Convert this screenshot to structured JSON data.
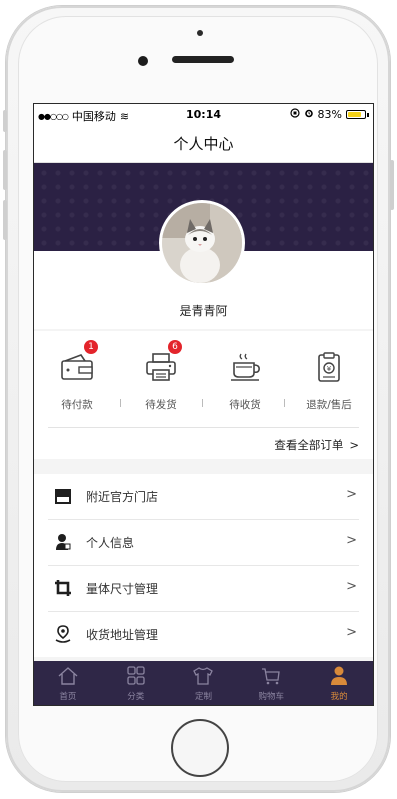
{
  "status_bar": {
    "signal": "●●○○○",
    "carrier": "中国移动",
    "wifi": "≋",
    "time": "10:14",
    "battery_percent": "83%",
    "battery_level": 0.83
  },
  "header": {
    "title": "个人中心"
  },
  "profile": {
    "username": "是青青阿"
  },
  "orders": {
    "items": [
      {
        "label": "待付款",
        "icon": "wallet-icon",
        "badge": "1"
      },
      {
        "label": "待发货",
        "icon": "printer-icon",
        "badge": "6"
      },
      {
        "label": "待收货",
        "icon": "coffee-cup-icon",
        "badge": ""
      },
      {
        "label": "退款/售后",
        "icon": "refund-clipboard-icon",
        "badge": ""
      }
    ],
    "view_all_label": "查看全部订单",
    "view_all_chevron": ">"
  },
  "menu": {
    "items": [
      {
        "label": "附近官方门店",
        "icon": "store-icon",
        "chevron": ">"
      },
      {
        "label": "个人信息",
        "icon": "person-icon",
        "chevron": ">"
      },
      {
        "label": "量体尺寸管理",
        "icon": "crop-icon",
        "chevron": ">"
      },
      {
        "label": "收货地址管理",
        "icon": "location-icon",
        "chevron": ">"
      }
    ]
  },
  "tabbar": {
    "items": [
      {
        "label": "首页",
        "icon": "home-icon"
      },
      {
        "label": "分类",
        "icon": "grid-icon"
      },
      {
        "label": "定制",
        "icon": "shirt-icon"
      },
      {
        "label": "购物车",
        "icon": "cart-icon"
      },
      {
        "label": "我的",
        "icon": "user-icon",
        "active": true
      }
    ]
  },
  "colors": {
    "banner": "#2b2144",
    "tabbar": "#2f2747",
    "active_tab": "#d98a3a",
    "badge": "#e3242b"
  }
}
